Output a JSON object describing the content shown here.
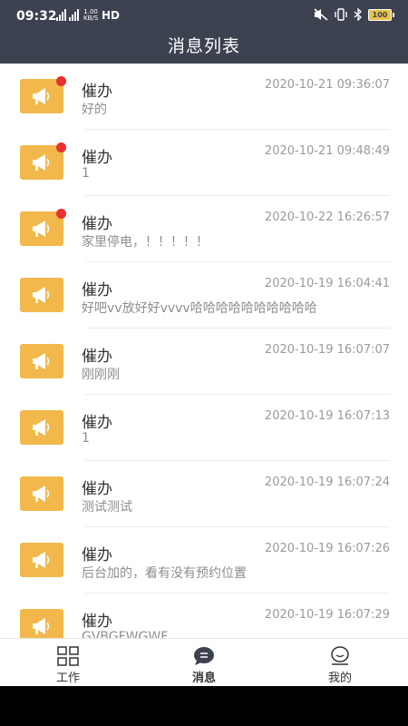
{
  "status_bar": {
    "time": "09:32",
    "network_speed_value": "1.00",
    "network_speed_unit": "KB/S",
    "hd": "HD",
    "battery": "100"
  },
  "header": {
    "title": "消息列表"
  },
  "messages": [
    {
      "name": "催办",
      "time": "2020-10-21 09:36:07",
      "preview": "好的",
      "unread": true
    },
    {
      "name": "催办",
      "time": "2020-10-21 09:48:49",
      "preview": "1",
      "unread": true
    },
    {
      "name": "催办",
      "time": "2020-10-22 16:26:57",
      "preview": "家里停电，！！！！！",
      "unread": true
    },
    {
      "name": "催办",
      "time": "2020-10-19 16:04:41",
      "preview": "好吧vv放好好vvvv哈哈哈哈哈哈哈哈哈哈",
      "unread": false
    },
    {
      "name": "催办",
      "time": "2020-10-19 16:07:07",
      "preview": "刚刚刚",
      "unread": false
    },
    {
      "name": "催办",
      "time": "2020-10-19 16:07:13",
      "preview": "1",
      "unread": false
    },
    {
      "name": "催办",
      "time": "2020-10-19 16:07:24",
      "preview": "测试测试",
      "unread": false
    },
    {
      "name": "催办",
      "time": "2020-10-19 16:07:26",
      "preview": "后台加的，看有没有预约位置",
      "unread": false
    },
    {
      "name": "催办",
      "time": "2020-10-19 16:07:29",
      "preview": "GVBGFWGWF",
      "unread": false
    }
  ],
  "tabbar": {
    "tabs": [
      {
        "label": "工作",
        "icon": "grid-icon",
        "active": false
      },
      {
        "label": "消息",
        "icon": "chat-bubble-icon",
        "active": true
      },
      {
        "label": "我的",
        "icon": "profile-face-icon",
        "active": false
      }
    ]
  },
  "colors": {
    "header_bg": "#3d4251",
    "icon_bg": "#f2b84b",
    "unread_dot": "#e8322f"
  }
}
